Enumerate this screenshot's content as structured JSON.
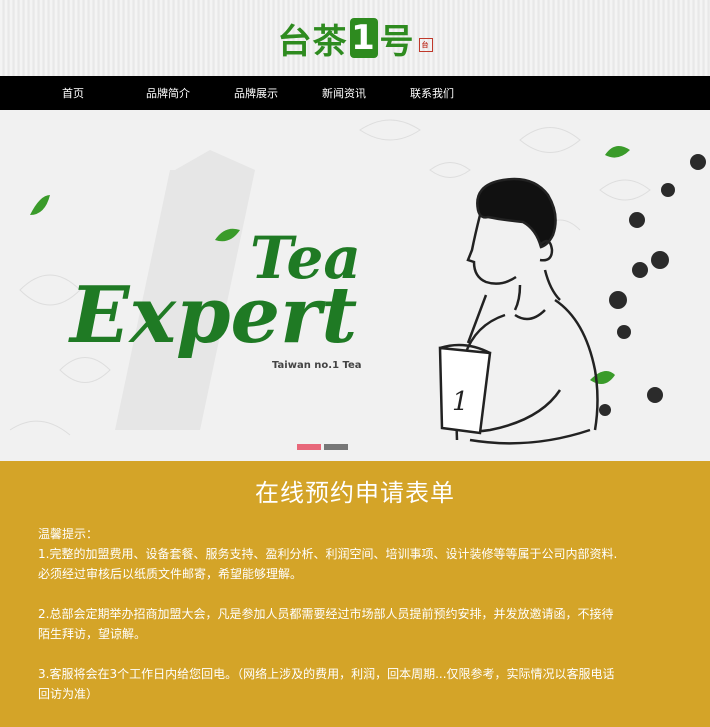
{
  "logo": {
    "part1": "台茶",
    "num": "1",
    "part2": "号",
    "seal": "台"
  },
  "nav": {
    "items": [
      "首页",
      "品牌简介",
      "品牌展示",
      "新闻资讯",
      "联系我们"
    ]
  },
  "banner": {
    "headline_1": "Tea",
    "headline_2": "Expert",
    "tagline": "Taiwan no.1 Tea",
    "cup_number": "1",
    "slides_count": 2,
    "active_slide": 1
  },
  "form": {
    "title": "在线预约申请表单",
    "tips_heading": "温馨提示：",
    "tips": [
      [
        "1.完整的加盟费用、设备套餐、服务支持、盈利分析、利润空间、培训事项、设计装修等等属于公司内部资料.",
        "必须经过审核后以纸质文件邮寄，希望能够理解。"
      ],
      [
        "2.总部会定期举办招商加盟大会，凡是参加人员都需要经过市场部人员提前预约安排，并发放邀请函，不接待",
        "陌生拜访，望谅解。"
      ],
      [
        "3.客服将会在3个工作日内给您回电。（网络上涉及的费用，利润，回本周期...仅限参考，实际情况以客服电话",
        "回访为准）"
      ]
    ]
  },
  "colors": {
    "brand_green": "#2e8b1f",
    "form_bg": "#d4a428",
    "nav_bg": "#000000",
    "dot_active": "#e8687a",
    "dot_inactive": "#777777"
  }
}
